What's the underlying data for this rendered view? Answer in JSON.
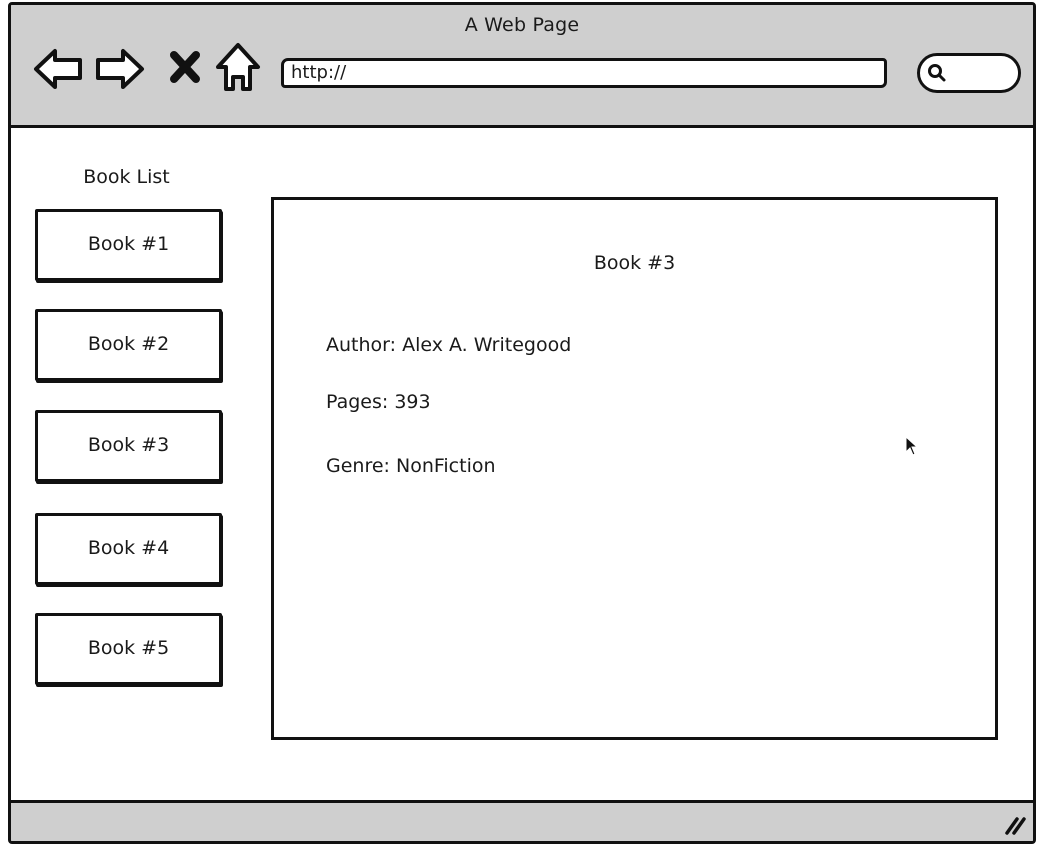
{
  "window": {
    "title": "A Web Page"
  },
  "toolbar": {
    "back_icon": "arrow-left-icon",
    "forward_icon": "arrow-right-icon",
    "stop_icon": "close-icon",
    "home_icon": "home-icon",
    "url": "http://",
    "search_icon": "search-icon"
  },
  "sidebar": {
    "title": "Book List",
    "items": [
      {
        "label": "Book #1"
      },
      {
        "label": "Book #2"
      },
      {
        "label": "Book #3"
      },
      {
        "label": "Book #4"
      },
      {
        "label": "Book #5"
      }
    ]
  },
  "detail": {
    "title": "Book #3",
    "author": "Author: Alex A. Writegood",
    "pages": "Pages: 393",
    "genre": "Genre: NonFiction"
  },
  "colors": {
    "chrome": "#cfcfcf",
    "outline": "#111111",
    "background": "#ffffff"
  }
}
